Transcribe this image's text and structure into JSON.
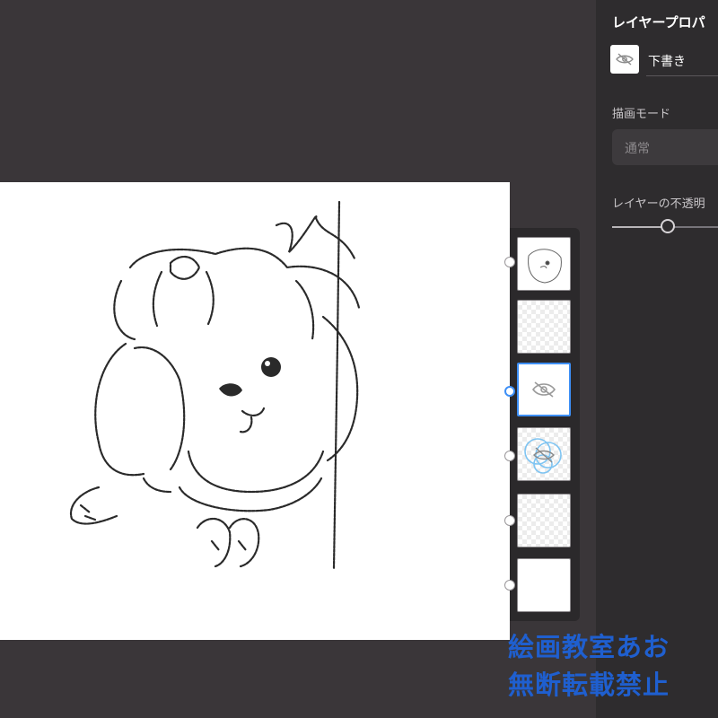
{
  "props_panel": {
    "title": "レイヤープロパ",
    "layer_name": "下書き",
    "blend_mode_label": "描画モード",
    "blend_mode_value": "通常",
    "opacity_label": "レイヤーの不透明",
    "opacity_value": 0.48
  },
  "layers": [
    {
      "name": "dog-sketch",
      "selected": false,
      "transparent": false
    },
    {
      "name": "empty",
      "selected": false,
      "transparent": true
    },
    {
      "name": "draft",
      "selected": true,
      "transparent": false
    },
    {
      "name": "guides",
      "selected": false,
      "transparent": true
    },
    {
      "name": "empty-2",
      "selected": false,
      "transparent": true
    },
    {
      "name": "background",
      "selected": false,
      "transparent": false
    }
  ],
  "watermark": {
    "line1": "絵画教室あお",
    "line2": "無断転載禁止"
  },
  "colors": {
    "accent": "#3d8ff6",
    "watermark": "#1f5fcf",
    "workspace": "#3a3639"
  }
}
